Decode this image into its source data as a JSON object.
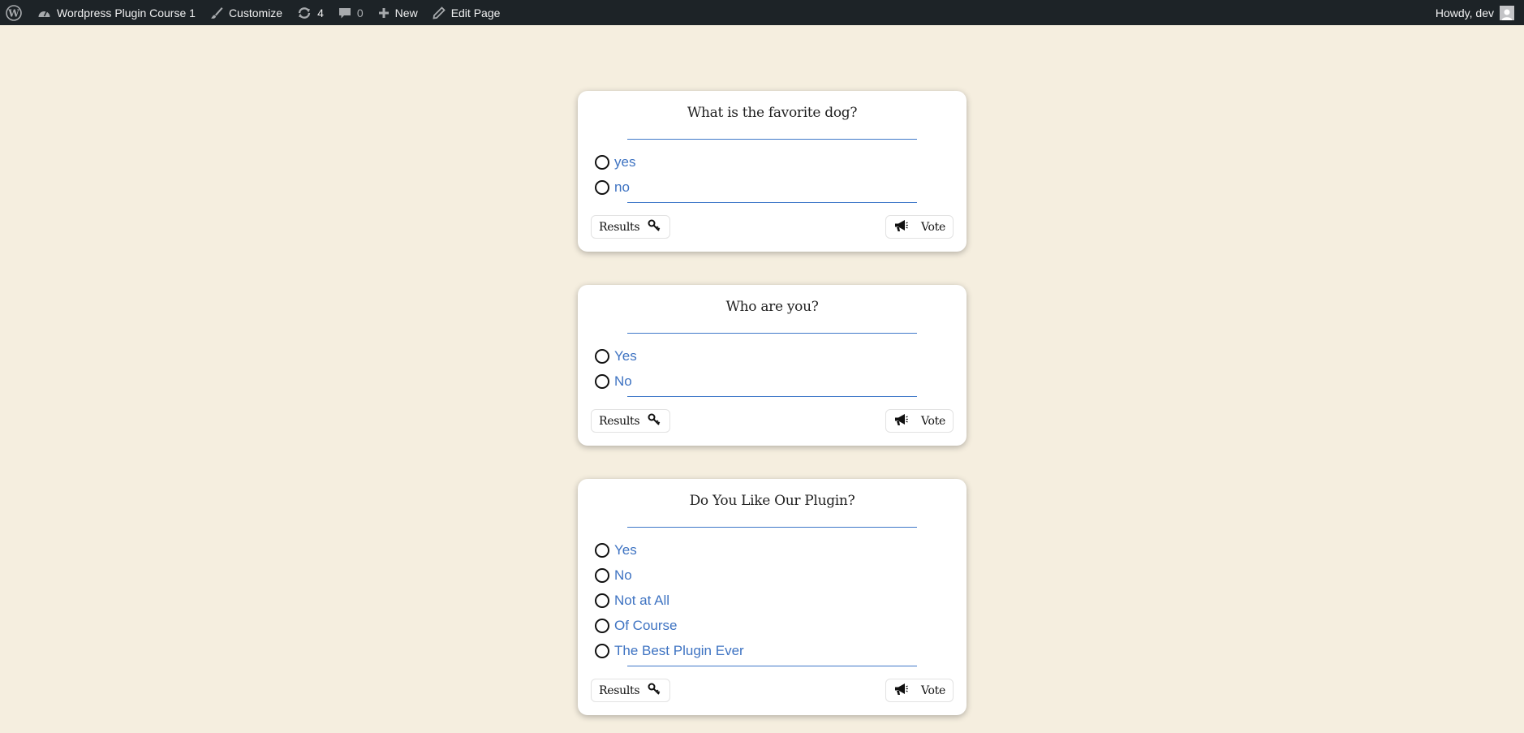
{
  "adminbar": {
    "site_name": "Wordpress Plugin Course 1",
    "customize": "Customize",
    "updates_count": "4",
    "comments_count": "0",
    "new_label": "New",
    "edit_page": "Edit Page",
    "howdy": "Howdy, dev"
  },
  "polls": [
    {
      "question": "What is the favorite dog?",
      "options": [
        "yes",
        "no"
      ],
      "results_label": "Results",
      "vote_label": "Vote"
    },
    {
      "question": "Who are you?",
      "options": [
        "Yes",
        "No"
      ],
      "results_label": "Results",
      "vote_label": "Vote"
    },
    {
      "question": "Do You Like Our Plugin?",
      "options": [
        "Yes",
        "No",
        "Not at All",
        "Of Course",
        "The Best Plugin Ever"
      ],
      "results_label": "Results",
      "vote_label": "Vote"
    }
  ],
  "colors": {
    "page_background": "#f5eedf",
    "admin_bar": "#1d2327",
    "option_text": "#3e73c2",
    "rule": "#3f78c9"
  }
}
